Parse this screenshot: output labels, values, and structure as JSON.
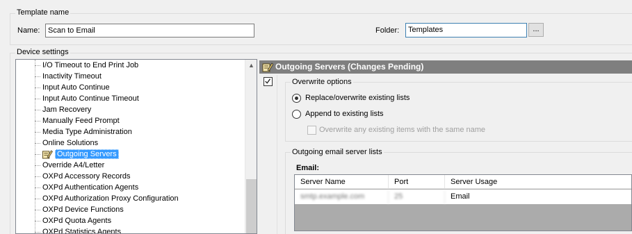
{
  "template": {
    "group_title": "Template name",
    "name_label": "Name:",
    "name_value": "Scan to Email",
    "folder_label": "Folder:",
    "folder_value": "Templates",
    "browse_label": "..."
  },
  "device_settings": {
    "group_title": "Device settings",
    "tree_items": [
      "I/O Timeout to End Print Job",
      "Inactivity Timeout",
      "Input Auto Continue",
      "Input Auto Continue Timeout",
      "Jam Recovery",
      "Manually Feed Prompt",
      "Media Type Administration",
      "Online Solutions",
      "Outgoing Servers",
      "Override A4/Letter",
      "OXPd Accessory Records",
      "OXPd Authentication Agents",
      "OXPd Authorization Proxy Configuration",
      "OXPd Device Functions",
      "OXPd Quota Agents",
      "OXPd Statistics Agents"
    ],
    "selected_item": "Outgoing Servers",
    "scroll_up_glyph": "▲"
  },
  "panel": {
    "header": "Outgoing Servers (Changes Pending)",
    "overwrite_title": "Overwrite options",
    "replace_label": "Replace/overwrite existing lists",
    "append_label": "Append to existing lists",
    "overwrite_items_label": "Overwrite any existing items with the same name",
    "email_lists_title": "Outgoing email server lists",
    "email_label": "Email:",
    "columns": [
      "Server Name",
      "Port",
      "Server Usage"
    ],
    "rows": [
      {
        "server_name": "smtp.example.com",
        "port": "25",
        "usage": "Email"
      }
    ]
  },
  "colors": {
    "header_bg": "#7f7f7f",
    "selection": "#3399ff",
    "grid_empty": "#ababab"
  },
  "icons": {
    "settings_icon": "pencil-note-icon",
    "enabled_checkbox": "checkbox-checked-icon"
  }
}
